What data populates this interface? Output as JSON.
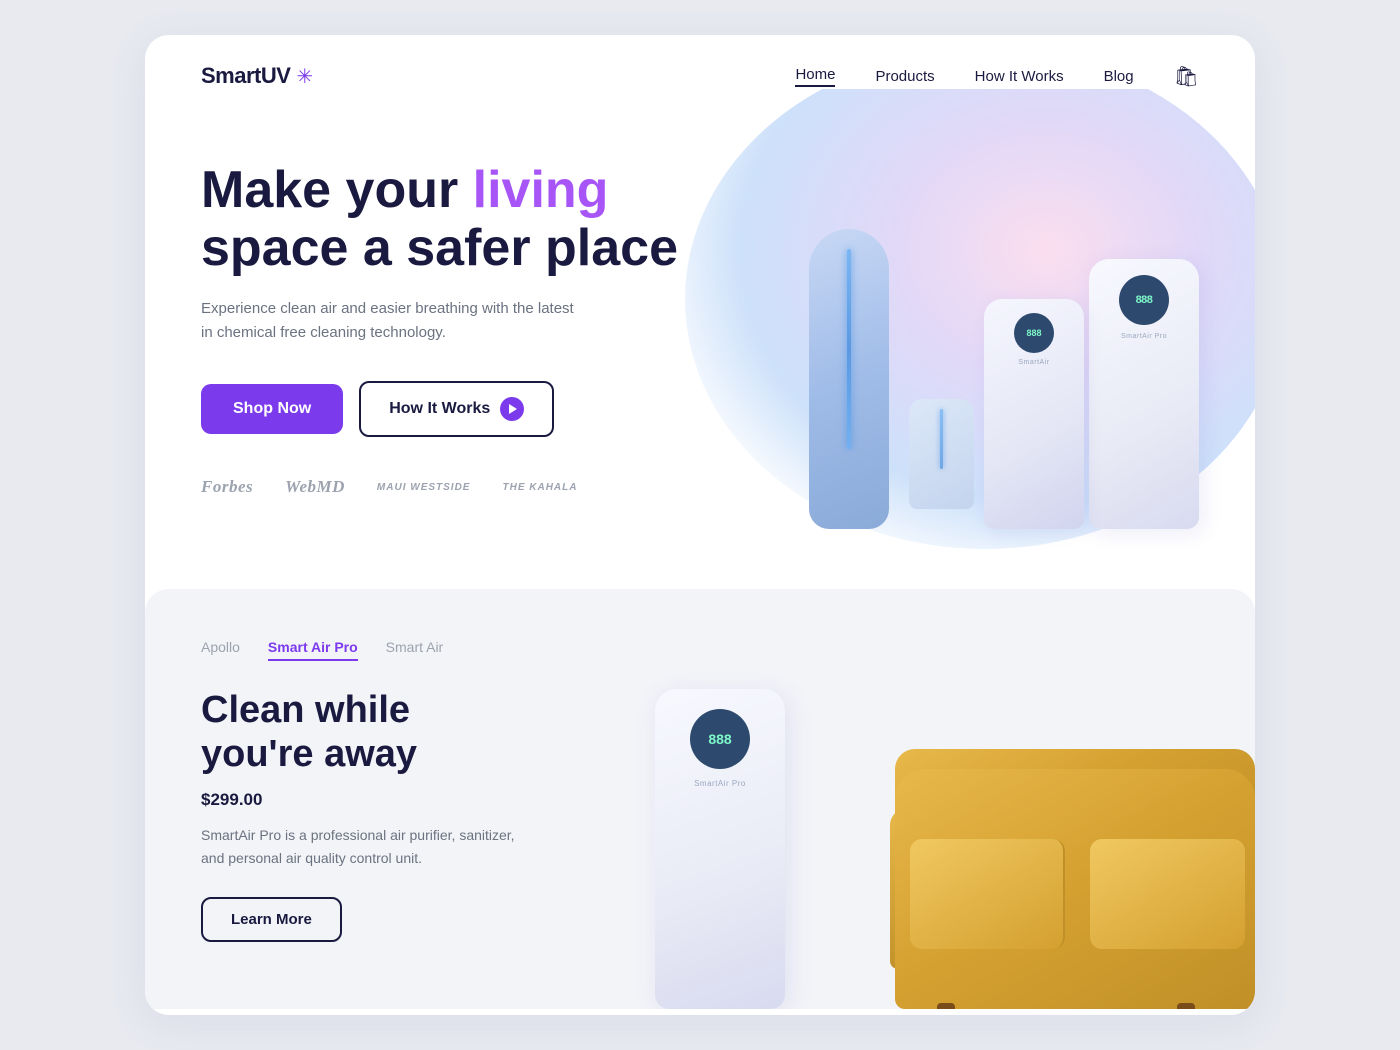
{
  "brand": {
    "name": "SmartUV",
    "suffix": "✳",
    "logo_aria": "SmartUV logo"
  },
  "nav": {
    "links": [
      {
        "label": "Home",
        "active": true
      },
      {
        "label": "Products",
        "active": false
      },
      {
        "label": "How It Works",
        "active": false
      },
      {
        "label": "Blog",
        "active": false
      }
    ],
    "cart_label": "🛍"
  },
  "hero": {
    "title_prefix": "Make your ",
    "title_highlight": "living",
    "title_suffix": "space a safer place",
    "subtitle": "Experience clean air and easier breathing with the latest in chemical free cleaning technology.",
    "btn_shop": "Shop Now",
    "btn_how": "How It Works"
  },
  "brands": [
    {
      "name": "Forbes",
      "style": "serif"
    },
    {
      "name": "WebMD",
      "style": "serif"
    },
    {
      "name": "MAUI WESTSIDE",
      "style": "small"
    },
    {
      "name": "THE KAHALA",
      "style": "small"
    }
  ],
  "product_section": {
    "tabs": [
      {
        "label": "Apollo",
        "active": false
      },
      {
        "label": "Smart Air Pro",
        "active": true
      },
      {
        "label": "Smart Air",
        "active": false
      }
    ],
    "title_line1": "Clean while",
    "title_line2": "you're away",
    "price": "$299.00",
    "description": "SmartAir Pro is a professional air purifier, sanitizer, and personal air quality control unit.",
    "btn_learn": "Learn More",
    "display_number": "888",
    "display_label": "SmartAir Pro"
  }
}
